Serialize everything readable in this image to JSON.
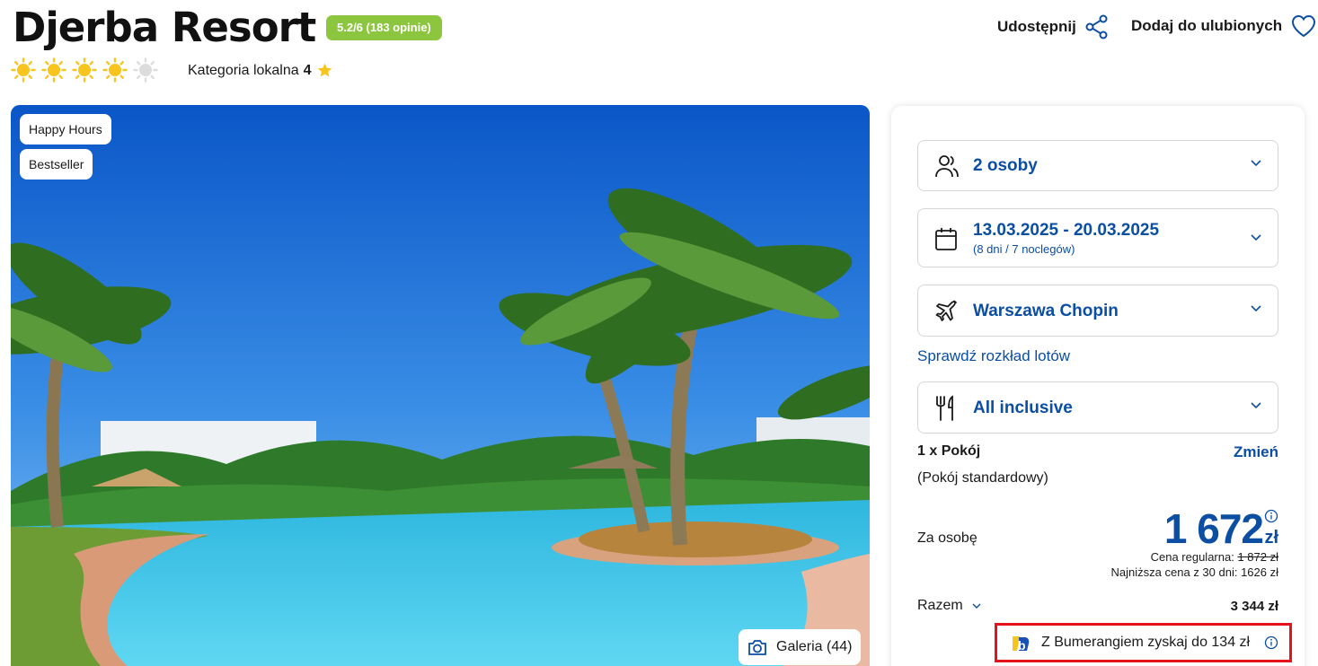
{
  "header": {
    "title": "Djerba Resort",
    "rating_badge": "5.2/6 (183 opinie)",
    "stars_filled": 4,
    "stars_total": 5,
    "category_label": "Kategoria lokalna",
    "category_value": "4",
    "share_label": "Udostępnij",
    "favorite_label": "Dodaj do ulubionych"
  },
  "hero": {
    "tags": [
      "Happy Hours",
      "Bestseller"
    ],
    "gallery_label": "Galeria (44)"
  },
  "booking": {
    "travelers": "2 osoby",
    "dates": "13.03.2025 - 20.03.2025",
    "dates_sub": "(8 dni / 7 noclegów)",
    "departure": "Warszawa Chopin",
    "flight_schedule_link": "Sprawdź rozkład lotów",
    "board": "All inclusive",
    "room_count": "1 x Pokój",
    "change_label": "Zmień",
    "room_type": "(Pokój standardowy)",
    "per_person_label": "Za osobę",
    "price": "1 672",
    "currency": "zł",
    "regular_label": "Cena regularna:",
    "regular_price": "1 872 zł",
    "lowest_price_text": "Najniższa cena z 30 dni: 1626 zł",
    "total_label": "Razem",
    "total_value": "3 344 zł",
    "bumerang_text": "Z Bumerangiem zyskaj do 134 zł"
  },
  "colors": {
    "brand_blue": "#0b4ea2",
    "rating_green": "#8cc63f",
    "sun_yellow": "#f7c51e",
    "highlight_red": "#e4121b"
  }
}
